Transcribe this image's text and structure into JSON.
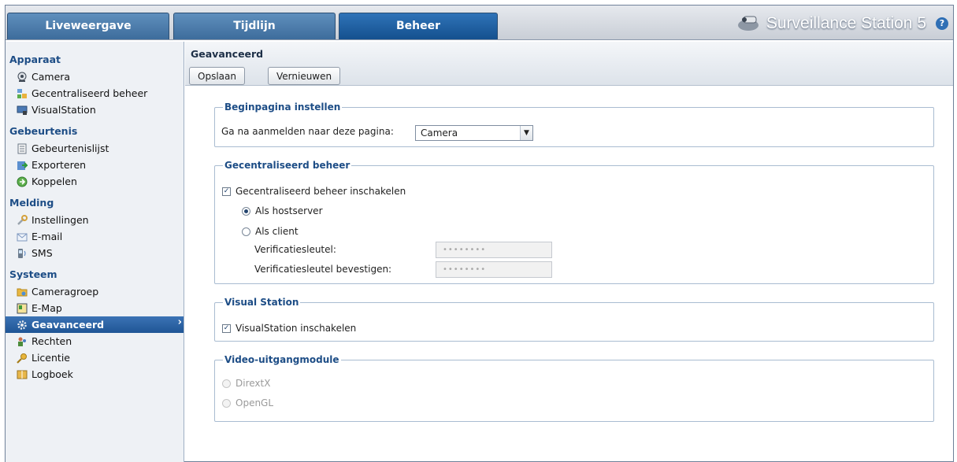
{
  "tabs": [
    {
      "label": "Liveweergave",
      "active": false
    },
    {
      "label": "Tijdlijn",
      "active": false
    },
    {
      "label": "Beheer",
      "active": true
    }
  ],
  "app_title": "Surveillance Station 5",
  "help_icon": "question-icon",
  "sidebar": {
    "groups": [
      {
        "label": "Apparaat",
        "items": [
          {
            "label": "Camera",
            "icon": "camera-icon"
          },
          {
            "label": "Gecentraliseerd beheer",
            "icon": "central-management-icon"
          },
          {
            "label": "VisualStation",
            "icon": "visualstation-icon"
          }
        ]
      },
      {
        "label": "Gebeurtenis",
        "items": [
          {
            "label": "Gebeurtenislijst",
            "icon": "event-list-icon"
          },
          {
            "label": "Exporteren",
            "icon": "export-icon"
          },
          {
            "label": "Koppelen",
            "icon": "mount-icon"
          }
        ]
      },
      {
        "label": "Melding",
        "items": [
          {
            "label": "Instellingen",
            "icon": "wrench-icon"
          },
          {
            "label": "E-mail",
            "icon": "envelope-icon"
          },
          {
            "label": "SMS",
            "icon": "sms-icon"
          }
        ]
      },
      {
        "label": "Systeem",
        "items": [
          {
            "label": "Cameragroep",
            "icon": "camera-group-icon"
          },
          {
            "label": "E-Map",
            "icon": "emap-icon"
          },
          {
            "label": "Geavanceerd",
            "icon": "gear-icon",
            "active": true
          },
          {
            "label": "Rechten",
            "icon": "privileges-icon"
          },
          {
            "label": "Licentie",
            "icon": "key-icon"
          },
          {
            "label": "Logboek",
            "icon": "book-icon"
          }
        ]
      }
    ]
  },
  "main": {
    "title": "Geavanceerd",
    "save_label": "Opslaan",
    "refresh_label": "Vernieuwen",
    "homepage": {
      "legend": "Beginpagina instellen",
      "label": "Ga na aanmelden naar deze pagina:",
      "value": "Camera"
    },
    "cms": {
      "legend": "Gecentraliseerd beheer",
      "enable_label": "Gecentraliseerd beheer inschakelen",
      "enabled": true,
      "host_label": "Als hostserver",
      "client_label": "Als client",
      "selected_mode": "host",
      "key_label": "Verificatiesleutel:",
      "key_confirm_label": "Verificatiesleutel bevestigen:",
      "key_mask": "••••••••",
      "key_confirm_mask": "••••••••"
    },
    "visual_station": {
      "legend": "Visual Station",
      "enable_label": "VisualStation inschakelen",
      "enabled": true
    },
    "video_output": {
      "legend": "Video-uitgangmodule",
      "option_directx": "DirextX",
      "option_opengl": "OpenGL"
    }
  }
}
